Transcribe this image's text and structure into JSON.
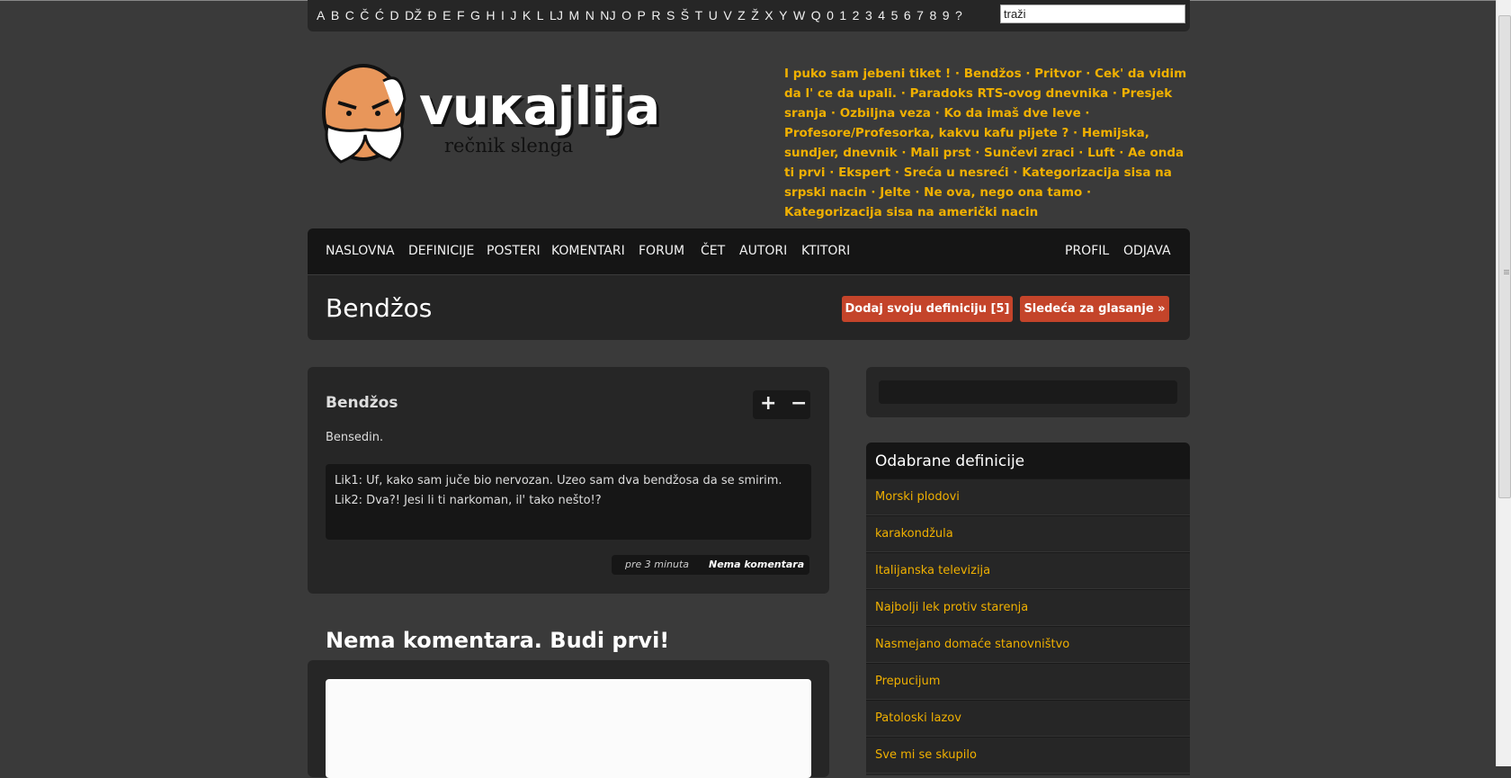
{
  "alphabet": [
    "A",
    "B",
    "C",
    "Č",
    "Ć",
    "D",
    "DŽ",
    "Đ",
    "E",
    "F",
    "G",
    "H",
    "I",
    "J",
    "K",
    "L",
    "LJ",
    "M",
    "N",
    "NJ",
    "O",
    "P",
    "R",
    "S",
    "Š",
    "T",
    "U",
    "V",
    "Z",
    "Ž",
    "X",
    "Y",
    "W",
    "Q",
    "0",
    "1",
    "2",
    "3",
    "4",
    "5",
    "6",
    "7",
    "8",
    "9",
    "?"
  ],
  "search": {
    "value": "traži"
  },
  "logo": {
    "wordmark": "vuкajlija",
    "tagline": "rečnik slenga"
  },
  "trending": [
    "I puko sam jebeni tiket !",
    "Bendžos",
    "Pritvor",
    "Cek' da vidim da l' ce da upali.",
    "Paradoks RTS-ovog dnevnika",
    "Presjek sranja",
    "Ozbiljna veza",
    "Ko da imaš dve leve",
    "Profesore/Profesorka, kakvu kafu pijete ?",
    "Hemijska, sundjer, dnevnik",
    "Mali prst",
    "Sunčevi zraci",
    "Luft",
    "Ae onda ti prvi",
    "Ekspert",
    "Sreća u nesreći",
    "Kategorizacija sisa na srpski nacin",
    "Jelte",
    "Ne ova, nego ona tamo",
    "Kategorizacija sisa na američki nacin"
  ],
  "nav": {
    "left": [
      "NASLOVNA",
      "DEFINICIJE",
      "POSTERI",
      "KOMENTARI",
      "FORUM",
      "ČET",
      "AUTORI",
      "KTITORI"
    ],
    "right": [
      "PROFIL",
      "ODJAVA"
    ]
  },
  "page": {
    "title": "Bendžos",
    "add_button": "Dodaj svoju definiciju [5]",
    "next_button": "Sledeća za glasanje »"
  },
  "definition": {
    "term": "Bendžos",
    "vote_up": "+",
    "vote_down": "−",
    "meaning": "Bensedin.",
    "example_1": "Lik1: Uf, kako sam juče bio nervozan. Uzeo sam dva bendžosa da se smirim.",
    "example_2": "Lik2: Dva?! Jesi li ti narkoman, il' tako nešto!?",
    "time": "pre 3 minuta",
    "comments": "Nema komentara"
  },
  "comments": {
    "heading": "Nema komentara. Budi prvi!"
  },
  "sidebar": {
    "title": "Odabrane definicije",
    "items": [
      "Morski plodovi",
      "karakondžula",
      "Italijanska televizija",
      "Najbolji lek protiv starenja",
      "Nasmejano domaće stanovništvo",
      "Prepucijum",
      "Patoloski lazov",
      "Sve mi se skupilo"
    ]
  },
  "colors": {
    "accent": "#f0b000",
    "button": "#c4442a",
    "background": "#3a3a3a"
  }
}
